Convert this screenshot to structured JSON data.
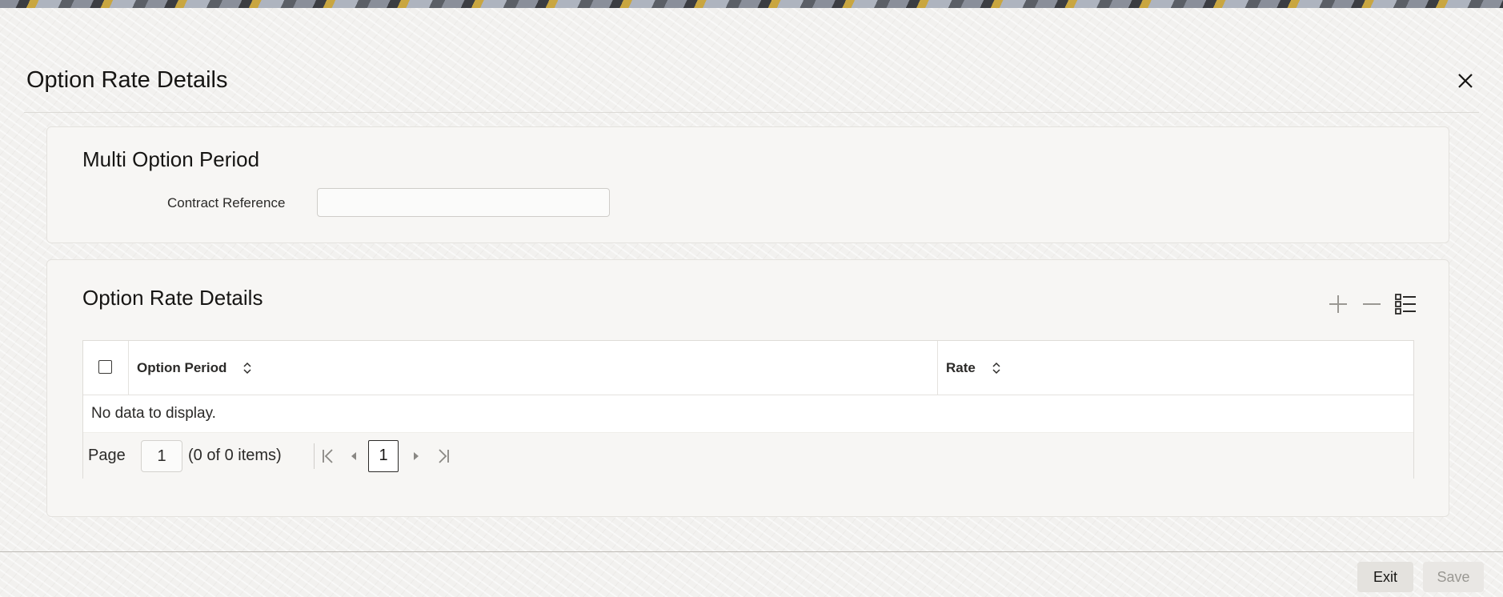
{
  "window": {
    "title": "Option Rate Details"
  },
  "multi_option_section": {
    "title": "Multi Option Period",
    "contract_reference": {
      "label": "Contract Reference",
      "value": ""
    }
  },
  "rate_section": {
    "title": "Option Rate Details",
    "toolbar": {
      "add_icon": "plus-icon",
      "remove_icon": "minus-icon",
      "view_icon": "list-view-icon"
    },
    "table": {
      "columns": [
        "Option Period",
        "Rate"
      ],
      "rows": [],
      "empty_message": "No data to display."
    },
    "pagination": {
      "page_label": "Page",
      "page_value": "1",
      "items_summary": "(0 of 0 items)",
      "current_page": "1"
    }
  },
  "footer": {
    "exit_label": "Exit",
    "save_label": "Save"
  }
}
